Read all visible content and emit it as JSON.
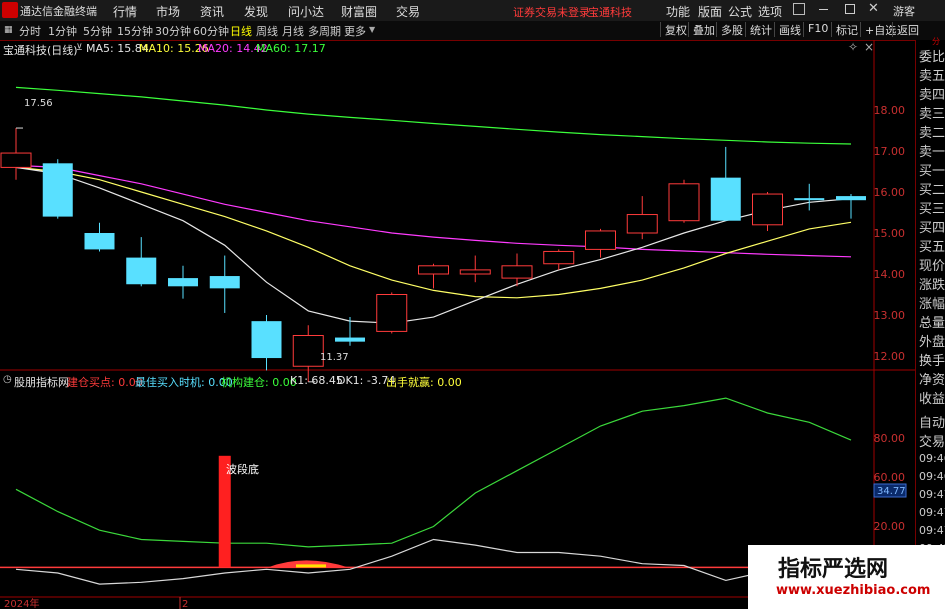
{
  "app": {
    "name": "通达信金融终端"
  },
  "menu": [
    "行情",
    "市场",
    "资讯",
    "发现",
    "问小达",
    "财富圈",
    "交易"
  ],
  "menu_right": [
    "功能",
    "版面",
    "公式",
    "选项"
  ],
  "warning": "证券交易未登录",
  "stock_title": "宝通科技",
  "guest": "游客",
  "periods": [
    {
      "label": "分时",
      "active": false
    },
    {
      "label": "1分钟",
      "active": false
    },
    {
      "label": "5分钟",
      "active": false
    },
    {
      "label": "15分钟",
      "active": false
    },
    {
      "label": "30分钟",
      "active": false
    },
    {
      "label": "60分钟",
      "active": false
    },
    {
      "label": "日线",
      "active": true
    },
    {
      "label": "周线",
      "active": false
    },
    {
      "label": "月线",
      "active": false
    },
    {
      "label": "多周期",
      "active": false
    },
    {
      "label": "更多",
      "active": false
    }
  ],
  "tools": [
    "复权",
    "叠加",
    "多股",
    "统计",
    "画线",
    "F10",
    "标记",
    "+自选",
    "返回"
  ],
  "ma_bar": {
    "stock": "宝通科技(日线)",
    "ma5": "MA5: 15.84",
    "ma10": "MA10: 15.26",
    "ma20": "MA20: 14.42",
    "ma60": "MA60: 17.17"
  },
  "indicator_bar": {
    "name": "股朋指标网",
    "i1": "建仓买点: 0.00",
    "i2": "最佳买入时机: 0.00",
    "i3": "机构建仓: 0.00",
    "k1": "K1: 68.45",
    "dk1": "DK1: -3.74",
    "i4": "出手就赢: 0.00"
  },
  "price_axis": [
    "18.00",
    "17.00",
    "16.00",
    "15.00",
    "14.00",
    "13.00",
    "12.00"
  ],
  "osc_axis": [
    "80.00",
    "60.00",
    "20.00"
  ],
  "osc_marker": "34.77",
  "osc_label": "波段底",
  "high_label": "17.56",
  "low_label": "11.37",
  "date_axis": {
    "year": "2024年",
    "month": "2"
  },
  "colors": {
    "up": "#ff3b3b",
    "down": "#59e0ff",
    "ma5": "#e6e6e6",
    "ma10": "#ffff66",
    "ma20": "#ff3bff",
    "ma60": "#3bff3b"
  },
  "chart_data": {
    "type": "candlestick",
    "candles": [
      {
        "o": 16.6,
        "h": 17.56,
        "l": 16.3,
        "c": 16.95
      },
      {
        "o": 16.7,
        "h": 16.8,
        "l": 15.35,
        "c": 15.4
      },
      {
        "o": 15.0,
        "h": 15.25,
        "l": 14.55,
        "c": 14.6
      },
      {
        "o": 14.4,
        "h": 14.9,
        "l": 13.7,
        "c": 13.75
      },
      {
        "o": 13.9,
        "h": 14.2,
        "l": 13.4,
        "c": 13.7
      },
      {
        "o": 13.95,
        "h": 14.45,
        "l": 13.05,
        "c": 13.65
      },
      {
        "o": 12.85,
        "h": 13.0,
        "l": 11.65,
        "c": 11.95
      },
      {
        "o": 11.75,
        "h": 12.75,
        "l": 11.37,
        "c": 12.5
      },
      {
        "o": 12.45,
        "h": 12.95,
        "l": 12.25,
        "c": 12.35
      },
      {
        "o": 12.6,
        "h": 13.55,
        "l": 12.55,
        "c": 13.5
      },
      {
        "o": 14.0,
        "h": 14.25,
        "l": 13.65,
        "c": 14.2
      },
      {
        "o": 14.0,
        "h": 14.45,
        "l": 13.8,
        "c": 14.1
      },
      {
        "o": 13.9,
        "h": 14.5,
        "l": 13.7,
        "c": 14.2
      },
      {
        "o": 14.25,
        "h": 14.6,
        "l": 14.1,
        "c": 14.55
      },
      {
        "o": 14.6,
        "h": 15.1,
        "l": 14.4,
        "c": 15.05
      },
      {
        "o": 15.0,
        "h": 15.9,
        "l": 14.85,
        "c": 15.45
      },
      {
        "o": 15.3,
        "h": 16.3,
        "l": 15.25,
        "c": 16.2
      },
      {
        "o": 16.35,
        "h": 17.1,
        "l": 15.3,
        "c": 15.3
      },
      {
        "o": 15.2,
        "h": 16.0,
        "l": 15.05,
        "c": 15.95
      },
      {
        "o": 15.85,
        "h": 16.2,
        "l": 15.55,
        "c": 15.8
      },
      {
        "o": 15.9,
        "h": 15.95,
        "l": 15.35,
        "c": 15.8
      }
    ],
    "ma5": [
      16.6,
      16.45,
      16.1,
      15.7,
      15.3,
      14.7,
      13.8,
      13.1,
      12.85,
      12.8,
      12.95,
      13.35,
      13.75,
      14.1,
      14.35,
      14.65,
      15.0,
      15.3,
      15.55,
      15.75,
      15.84
    ],
    "ma10": [
      16.6,
      16.5,
      16.3,
      16.0,
      15.7,
      15.4,
      15.05,
      14.65,
      14.2,
      13.85,
      13.6,
      13.45,
      13.42,
      13.5,
      13.65,
      13.85,
      14.15,
      14.5,
      14.8,
      15.1,
      15.26
    ],
    "ma20": [
      16.65,
      16.6,
      16.4,
      16.2,
      15.95,
      15.7,
      15.5,
      15.3,
      15.15,
      15.0,
      14.9,
      14.82,
      14.75,
      14.7,
      14.66,
      14.6,
      14.56,
      14.52,
      14.48,
      14.45,
      14.42
    ],
    "ma60": [
      18.55,
      18.48,
      18.4,
      18.32,
      18.22,
      18.12,
      18.0,
      17.9,
      17.82,
      17.75,
      17.67,
      17.6,
      17.53,
      17.46,
      17.4,
      17.35,
      17.3,
      17.26,
      17.22,
      17.19,
      17.17
    ],
    "k1": [
      42,
      30,
      20,
      15,
      14,
      13,
      13,
      11,
      12,
      13,
      22,
      40,
      52,
      64,
      76,
      84,
      87,
      91,
      83,
      78,
      68.45
    ],
    "dk1": [
      -1,
      -3,
      -9,
      -8,
      -6,
      -3,
      -1,
      -3,
      -1,
      6,
      15,
      12,
      8,
      8,
      6,
      2,
      1,
      -7,
      -2,
      -4,
      -3.74
    ],
    "osc_ylim": [
      -10,
      90
    ],
    "signals": [
      {
        "index": 5,
        "value": 60
      }
    ]
  }
}
